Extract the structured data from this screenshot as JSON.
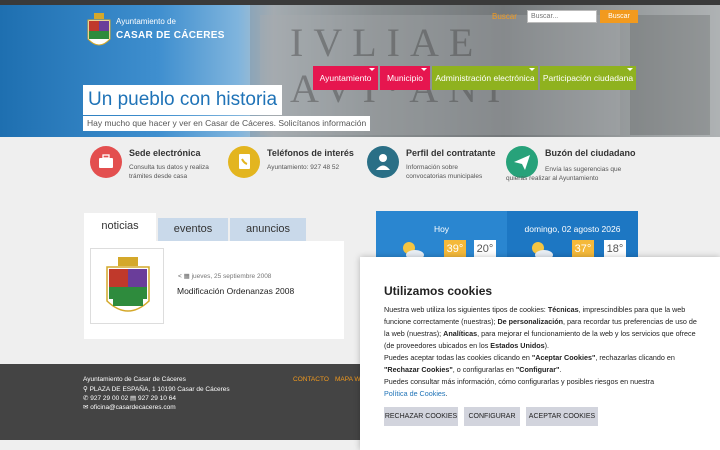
{
  "header": {
    "brand_top": "Ayuntamiento de",
    "brand_main": "CASAR DE CÁCERES",
    "search_label": "Buscar",
    "search_placeholder": "Buscar...",
    "search_button": "Buscar"
  },
  "nav": [
    {
      "label": "Ayuntamiento",
      "color": "#e6164f"
    },
    {
      "label": "Municipio",
      "color": "#e6164f"
    },
    {
      "label": "Administración electrónica",
      "color": "#8fb21f"
    },
    {
      "label": "Participación ciudadana",
      "color": "#8fb21f"
    }
  ],
  "hero": {
    "slogan": "Un pueblo con historia",
    "sub_slogan": "Hay mucho que hacer y ver en Casar de Cáceres. Solicítanos información"
  },
  "services": [
    {
      "title": "Sede electrónica",
      "desc": "Consulta tus datos y realiza trámites desde casa",
      "icon": "briefcase-icon",
      "color": "#e34f4f"
    },
    {
      "title": "Teléfonos de interés",
      "desc": "Ayuntamiento: 927 48 52",
      "icon": "phone-book-icon",
      "color": "#e3b51f"
    },
    {
      "title": "Perfil del contratante",
      "desc": "Información sobre convocatorias municipales",
      "icon": "user-icon",
      "color": "#2a6f86"
    },
    {
      "title": "Buzón del ciudadano",
      "desc": "Envía las sugerencias que quieras realizar al Ayuntamiento",
      "icon": "send-icon",
      "color": "#27a27a"
    }
  ],
  "news": {
    "tabs": [
      "noticias",
      "eventos",
      "anuncios"
    ],
    "item": {
      "date": "jueves, 25 septiembre 2008",
      "title": "Modificación Ordenanzas 2008"
    }
  },
  "weather": {
    "today": {
      "label": "Hoy",
      "hi": "39°",
      "lo": "20°"
    },
    "tomorrow": {
      "label": "domingo, 02 agosto 2026",
      "hi": "37°",
      "lo": "18°"
    }
  },
  "footer": {
    "name": "Ayuntamiento de Casar de Cáceres",
    "address": "PLAZA DE ESPAÑA, 1 10190 Casar de Cáceres",
    "phones": "927 29 00 02",
    "fax": "927 29 10 64",
    "email": "oficina@casardecaceres.com",
    "links": [
      "CONTACTO",
      "MAPA WEB"
    ]
  },
  "cookies": {
    "title": "Utilizamos cookies",
    "p1_a": "Nuestra web utiliza los siguientes tipos de cookies: ",
    "p1_b": "Técnicas",
    "p1_c": ", imprescindibles para que la web funcione correctamente (nuestras); ",
    "p1_d": "De personalización",
    "p1_e": ", para recordar tus preferencias de uso de la web (nuestras); ",
    "p1_f": "Analíticas",
    "p1_g": ", para mejorar el funcionamiento de la web y los servicios que ofrece (de proveedores ubicados en los ",
    "p1_h": "Estados Unidos",
    "p1_i": ").",
    "p2_a": "Puedes aceptar todas las cookies clicando en ",
    "p2_b": "\"Aceptar Cookies\"",
    "p2_c": ", rechazarlas clicando en ",
    "p2_d": "\"Rechazar Cookies\"",
    "p2_e": ", o configurarlas en ",
    "p2_f": "\"Configurar\"",
    "p2_g": ".",
    "p3": "Puedes consultar más información, cómo configurarlas y posibles riesgos en nuestra",
    "p3_link": "Política de Cookies",
    "p3_end": ".",
    "btn_reject": "RECHAZAR COOKIES",
    "btn_config": "CONFIGURAR",
    "btn_accept": "ACEPTAR COOKIES"
  }
}
